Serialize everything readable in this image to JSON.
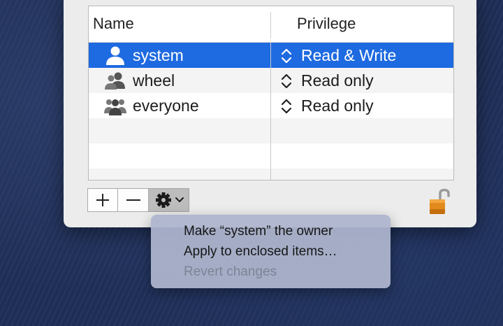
{
  "table": {
    "columns": {
      "name": "Name",
      "privilege": "Privilege"
    },
    "rows": [
      {
        "name": "system",
        "privilege": "Read & Write",
        "icon": "user-icon",
        "selected": true
      },
      {
        "name": "wheel",
        "privilege": "Read only",
        "icon": "group-icon",
        "selected": false
      },
      {
        "name": "everyone",
        "privilege": "Read only",
        "icon": "everyone-icon",
        "selected": false
      }
    ],
    "empty_rows": 2
  },
  "toolbar": {
    "add": "+",
    "remove": "−",
    "action_icon": "gear-icon",
    "dropdown_icon": "chevron-down-icon"
  },
  "lock": {
    "state": "unlocked",
    "icon": "unlocked-padlock-icon"
  },
  "menu": {
    "items": [
      {
        "label": "Make “system” the owner",
        "enabled": true
      },
      {
        "label": "Apply to enclosed items…",
        "enabled": true
      },
      {
        "label": "Revert changes",
        "enabled": false
      }
    ]
  },
  "colors": {
    "selection": "#1e6ae0",
    "panel": "#ececec",
    "menu": "#adb5cd",
    "desktop": "#1f2f58",
    "lock": "#e28a1c"
  }
}
